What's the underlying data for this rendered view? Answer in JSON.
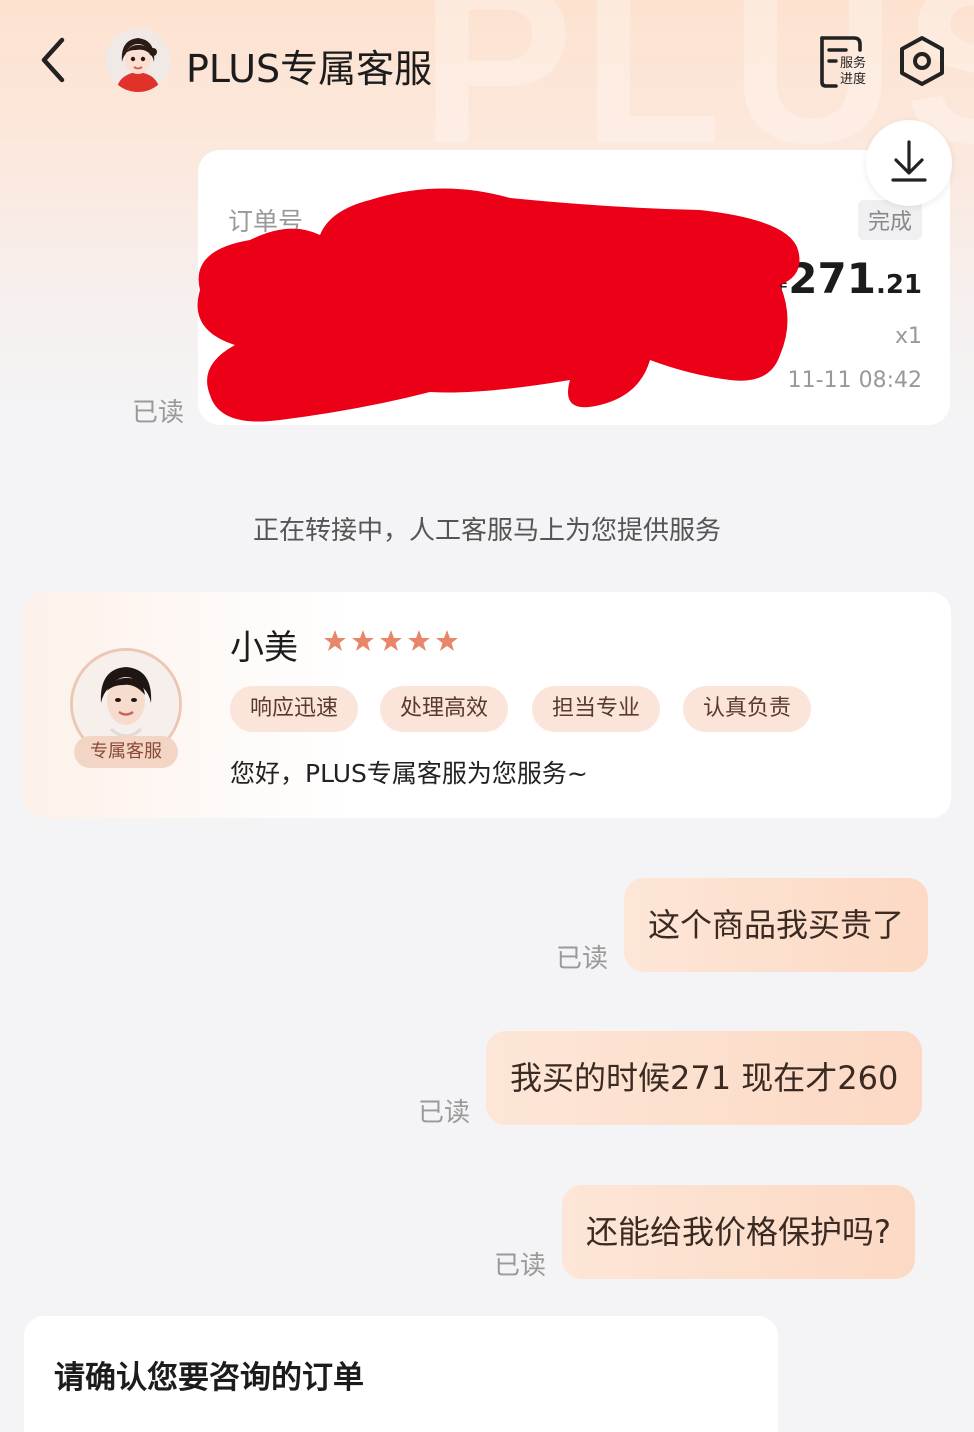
{
  "header": {
    "title": "PLUS专属客服",
    "watermark": "PLUS",
    "progress_icon_text": [
      "服务",
      "进度"
    ]
  },
  "order": {
    "label": "订单号",
    "status": "完成",
    "currency": "¥",
    "price_int": "271",
    "price_dec": ".21",
    "qty": "x1",
    "time": "11-11 08:42",
    "read": "已读"
  },
  "system": {
    "transfer_notice": "正在转接中，人工客服马上为您提供服务"
  },
  "agent": {
    "name": "小美",
    "badge": "专属客服",
    "rating": 5,
    "tags": [
      "响应迅速",
      "处理高效",
      "担当专业",
      "认真负责"
    ],
    "greeting": "您好，PLUS专属客服为您服务~"
  },
  "messages": [
    {
      "text": "这个商品我买贵了",
      "read": "已读"
    },
    {
      "text": "我买的时候271  现在才260",
      "read": "已读"
    },
    {
      "text": "还能给我价格保护吗?",
      "read": "已读"
    }
  ],
  "confirm": {
    "title": "请确认您要咨询的订单"
  },
  "colors": {
    "accent": "#e9866a",
    "bubble": "#fcdcc8",
    "redaction": "#ec0017"
  }
}
